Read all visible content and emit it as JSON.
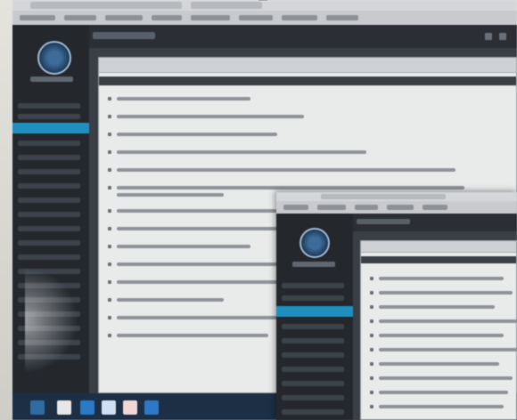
{
  "screen": {
    "description_visible_text": "",
    "note": ""
  }
}
